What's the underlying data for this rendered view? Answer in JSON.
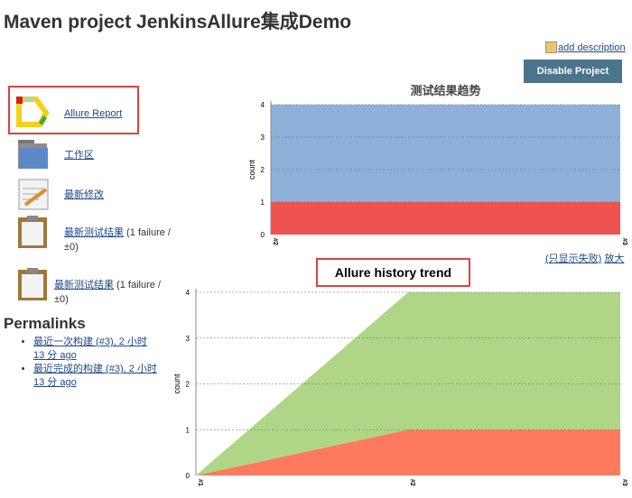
{
  "title": "Maven project JenkinsAllure集成Demo",
  "add_description": "add description",
  "disable_button": "Disable Project",
  "sidebar": [
    {
      "label": "Allure Report",
      "icon": "allure-icon"
    },
    {
      "label": "工作区",
      "icon": "folder-icon"
    },
    {
      "label": "最新修改",
      "icon": "notepad-icon"
    },
    {
      "label": "最新测试结果",
      "suffix": " (1 failure / ±0)",
      "icon": "clipboard-icon"
    },
    {
      "label": "最新测试结果",
      "suffix": " (1 failure / ±0)",
      "icon": "clipboard-icon"
    }
  ],
  "permalinks": {
    "heading": "Permalinks",
    "items": [
      "最近一次构建 (#3), 2 小时 13 分 ago",
      "最近完成的构建 (#3), 2 小时 13 分 ago"
    ]
  },
  "trend_links": {
    "only_failed": "(只显示失败)",
    "enlarge": "放大"
  },
  "allure_trend_heading": "Allure history trend",
  "chart_data": [
    {
      "type": "area",
      "title": "测试结果趋势",
      "ylabel": "count",
      "categories": [
        "#2",
        "#3"
      ],
      "ylim": [
        0,
        4
      ],
      "yticks": [
        0,
        1,
        2,
        3,
        4
      ],
      "series": [
        {
          "values": [
            1,
            1
          ],
          "color": "#ef5350"
        },
        {
          "values": [
            3,
            3
          ],
          "color": "#8eb0d8"
        }
      ],
      "stacked": true,
      "grid": true
    },
    {
      "type": "area",
      "title": "",
      "ylabel": "count",
      "categories": [
        "#1",
        "#2",
        "#3"
      ],
      "ylim": [
        0,
        4
      ],
      "yticks": [
        0,
        1,
        2,
        3,
        4
      ],
      "series": [
        {
          "values": [
            0,
            1,
            1
          ],
          "color": "#fd7a5f"
        },
        {
          "values": [
            0,
            3,
            3
          ],
          "color": "#aed686"
        }
      ],
      "stacked": true,
      "grid": true
    }
  ]
}
